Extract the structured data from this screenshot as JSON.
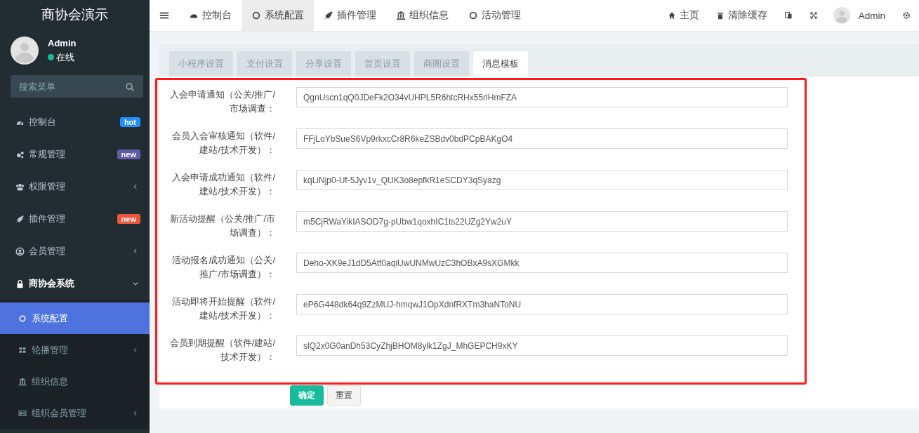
{
  "brand": "商协会演示",
  "user": {
    "name": "Admin",
    "status": "在线",
    "online": true
  },
  "search": {
    "placeholder": "搜索菜单"
  },
  "sidebar": {
    "items": [
      {
        "label": "控制台",
        "kind": "link",
        "badge": {
          "text": "hot",
          "color": "#1e90ff"
        }
      },
      {
        "label": "常规管理",
        "kind": "link",
        "badge": {
          "text": "new",
          "color": "#605ca8"
        }
      },
      {
        "label": "权限管理",
        "kind": "group",
        "expanded": false
      },
      {
        "label": "插件管理",
        "kind": "link",
        "badge": {
          "text": "new",
          "color": "#f0543c"
        }
      },
      {
        "label": "会员管理",
        "kind": "group",
        "expanded": false
      },
      {
        "label": "商协会系统",
        "kind": "group",
        "expanded": true,
        "children": [
          {
            "label": "系统配置",
            "kind": "link",
            "selected": true
          },
          {
            "label": "轮播管理",
            "kind": "group",
            "selected": false
          },
          {
            "label": "组织信息",
            "kind": "link",
            "selected": false
          },
          {
            "label": "组织会员管理",
            "kind": "group",
            "selected": false
          }
        ]
      }
    ]
  },
  "top_nav": {
    "tabs": [
      {
        "label": "控制台",
        "selected": false
      },
      {
        "label": "系统配置",
        "selected": true
      },
      {
        "label": "插件管理",
        "selected": false
      },
      {
        "label": "组织信息",
        "selected": false
      },
      {
        "label": "活动管理",
        "selected": false
      }
    ],
    "links": [
      "主页",
      "清除缓存"
    ],
    "user": "Admin"
  },
  "tabs": [
    {
      "label": "小程序设置",
      "selected": false
    },
    {
      "label": "支付设置",
      "selected": false
    },
    {
      "label": "分享设置",
      "selected": false
    },
    {
      "label": "首页设置",
      "selected": false
    },
    {
      "label": "商圈设置",
      "selected": false
    },
    {
      "label": "消息模板",
      "selected": true
    }
  ],
  "form": {
    "fields": [
      {
        "label": "入会申请通知（公关/推广/市场调查：",
        "value": "QgnUscn1qQ0JDeFk2O34vUHPL5R6htcRHx55rlHmFZA"
      },
      {
        "label": "会员入会审核通知（软件/建站/技术开发）：",
        "value": "FFjLoYbSueS6Vp9rkxcCr8R6keZSBdv0bdPCpBAKgO4"
      },
      {
        "label": "入会申请成功通知（软件/建站/技术开发）：",
        "value": "kqLiNjp0-Uf-5Jyv1v_QUK3o8epfkR1eSCDY3qSyazg"
      },
      {
        "label": "新活动提醒（公关/推广/市场调查）：",
        "value": "m5CjRWaYikIASOD7g-pUbw1qoxhIC1ts22UZg2Yw2uY"
      },
      {
        "label": "活动报名成功通知（公关/推广/市场调查）：",
        "value": "Deho-XK9eJ1dD5Atf0aqiUwUNMwUzC3hOBxA9sXGMkk"
      },
      {
        "label": "活动即将开始提醒（软件/建站/技术开发）：",
        "value": "eP6G448dk64q9ZzMUJ-hmqwJ1OpXdnfRXTm3haNToNU"
      },
      {
        "label": "会员到期提醒（软件/建站/技术开发）：",
        "value": "slQ2x0G0anDh53CyZhjBHOM8ylk1ZgJ_MhGEPCH9xKY"
      }
    ],
    "highlighted": true,
    "buttons": [
      {
        "label": "确定",
        "kind": "primary"
      },
      {
        "label": "重置",
        "kind": "default"
      }
    ]
  }
}
